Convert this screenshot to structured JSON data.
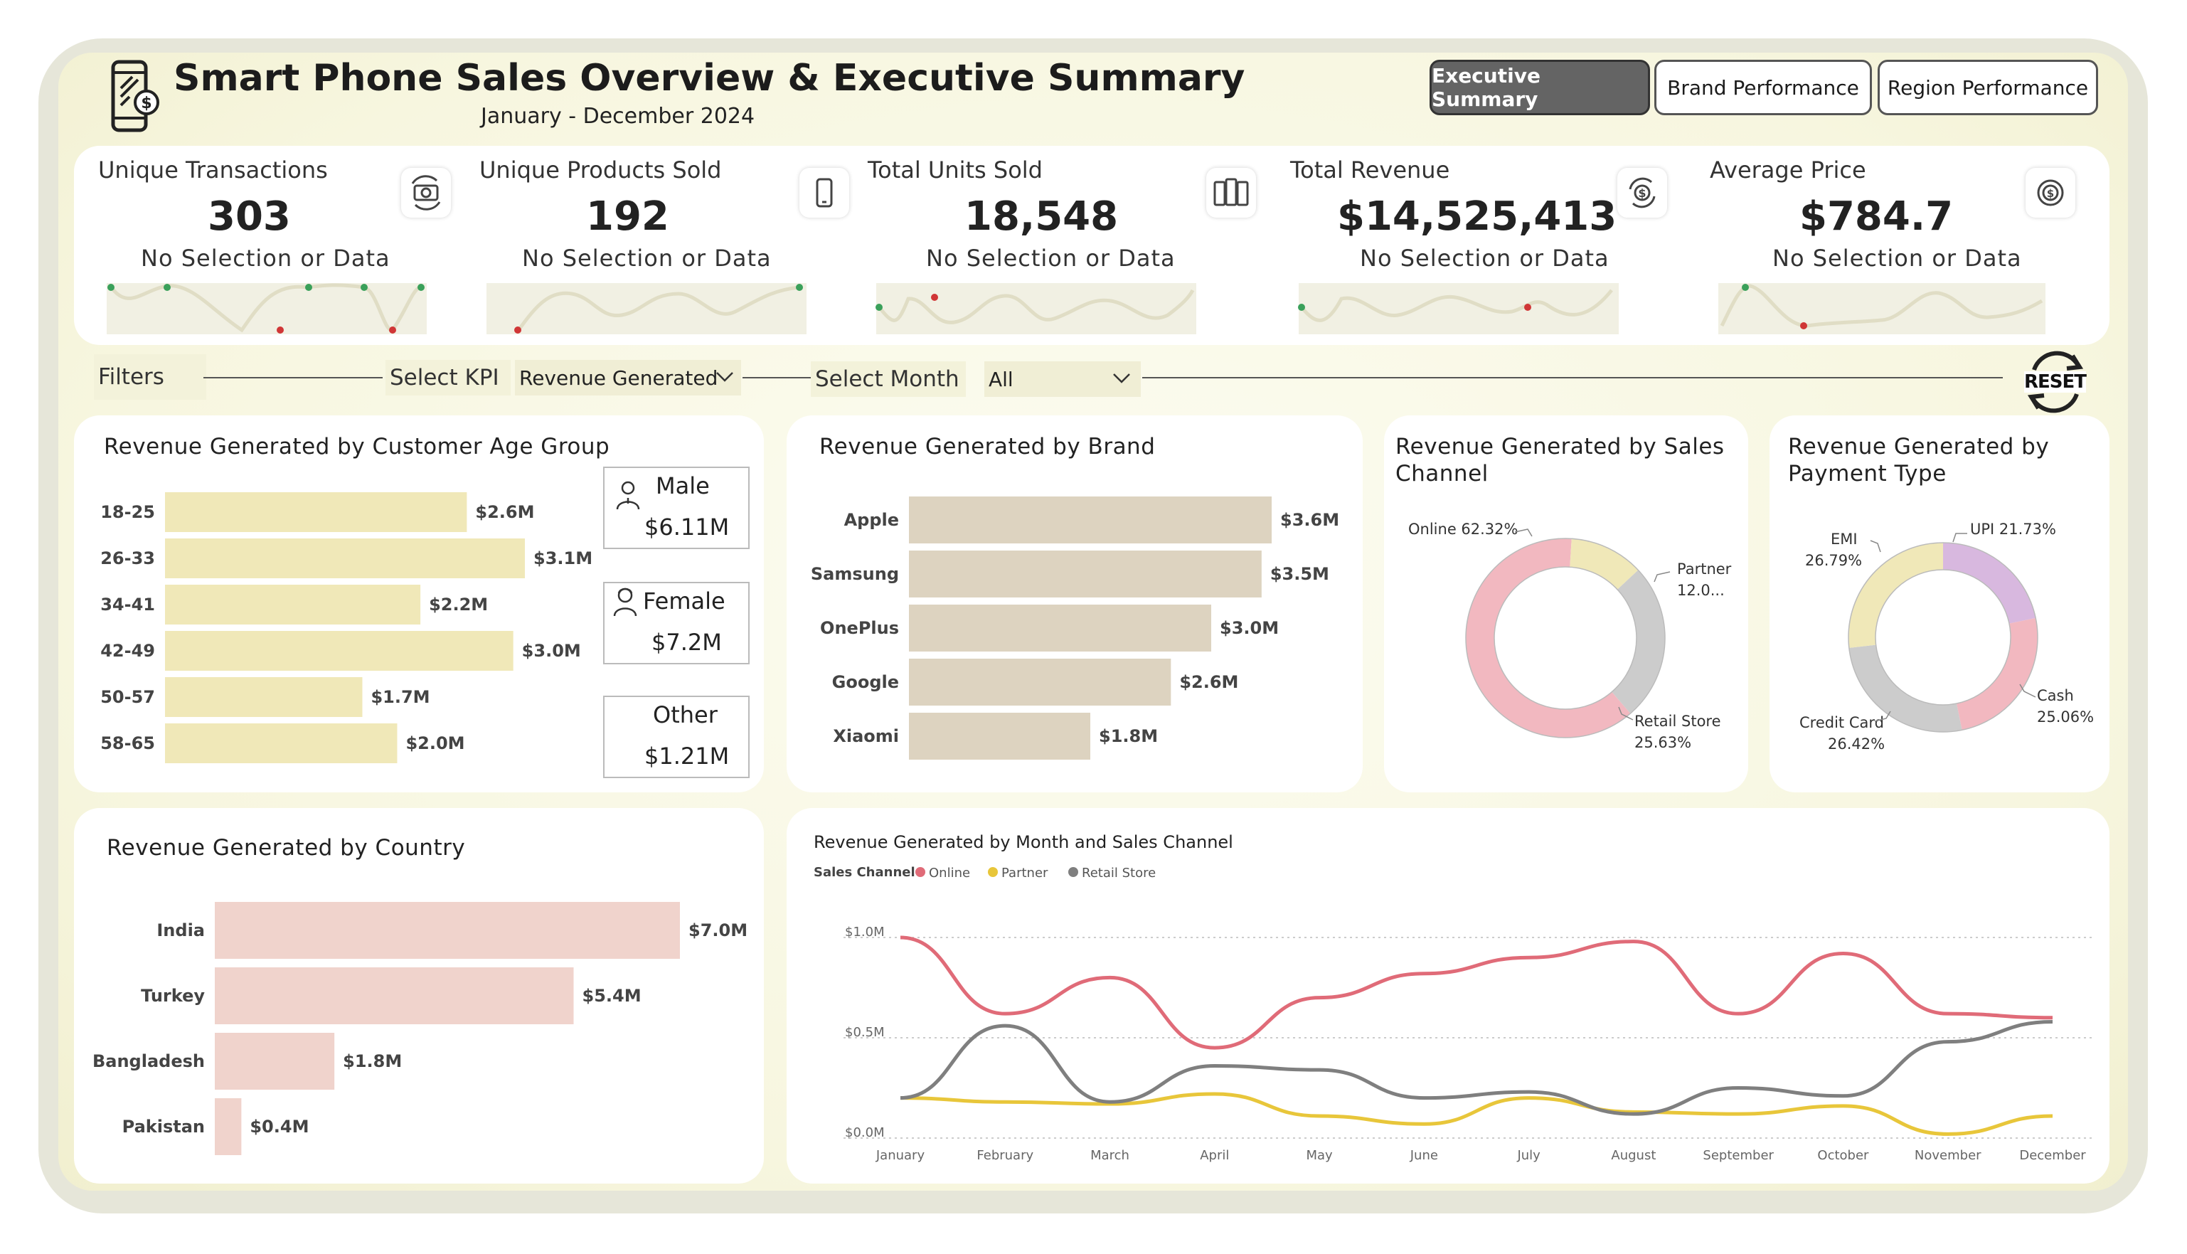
{
  "header": {
    "title": "Smart Phone Sales Overview & Executive Summary",
    "subtitle": "January - December 2024",
    "tabs": [
      "Executive Summary",
      "Brand Performance",
      "Region Performance"
    ],
    "active_tab": "Executive Summary"
  },
  "kpis": [
    {
      "label": "Unique Transactions",
      "value": "303",
      "sub": "No Selection or Data",
      "icon": "money-cycle-icon"
    },
    {
      "label": "Unique Products Sold",
      "value": "192",
      "sub": "No Selection or Data",
      "icon": "phone-icon"
    },
    {
      "label": "Total Units Sold",
      "value": "18,548",
      "sub": "No Selection or Data",
      "icon": "phones-stack-icon"
    },
    {
      "label": "Total Revenue",
      "value": "$14,525,413",
      "sub": "No Selection or Data",
      "icon": "dollar-cycle-icon"
    },
    {
      "label": "Average Price",
      "value": "$784.7",
      "sub": "No Selection or Data",
      "icon": "dollar-coin-icon"
    }
  ],
  "filters": {
    "label": "Filters",
    "kpi_label": "Select KPI",
    "kpi_value": "Revenue Generated",
    "month_label": "Select Month",
    "month_value": "All",
    "reset_label": "RESET"
  },
  "age_chart": {
    "title": "Revenue Generated by Customer Age Group",
    "chart_data": {
      "type": "bar",
      "categories": [
        "18-25",
        "26-33",
        "34-41",
        "42-49",
        "50-57",
        "58-65"
      ],
      "values": [
        2.6,
        3.1,
        2.2,
        3.0,
        1.7,
        2.0
      ],
      "labels": [
        "$2.6M",
        "$3.1M",
        "$2.2M",
        "$3.0M",
        "$1.7M",
        "$2.0M"
      ],
      "color": "#f0e8b8"
    }
  },
  "gender_cards": [
    {
      "label": "Male",
      "value": "$6.11M",
      "icon": "male-person-icon"
    },
    {
      "label": "Female",
      "value": "$7.2M",
      "icon": "female-person-icon"
    },
    {
      "label": "Other",
      "value": "$1.21M"
    }
  ],
  "brand_chart": {
    "title": "Revenue Generated by Brand",
    "chart_data": {
      "type": "bar",
      "categories": [
        "Apple",
        "Samsung",
        "OnePlus",
        "Google",
        "Xiaomi"
      ],
      "values": [
        3.6,
        3.5,
        3.0,
        2.6,
        1.8
      ],
      "labels": [
        "$3.6M",
        "$3.5M",
        "$3.0M",
        "$2.6M",
        "$1.8M"
      ],
      "color": "#ddd3c0"
    }
  },
  "channel_chart": {
    "title_lines": [
      "Revenue Generated by Sales",
      "Channel"
    ],
    "chart_data": {
      "type": "pie",
      "categories": [
        "Online",
        "Partner",
        "Retail Store"
      ],
      "values": [
        62.32,
        12.05,
        25.63
      ],
      "colors": [
        "#f2b8c0",
        "#f0e8b8",
        "#cccccc"
      ],
      "labels": [
        "Online 62.32%",
        "Partner",
        "12.0...",
        "Retail Store",
        "25.63%"
      ]
    }
  },
  "payment_chart": {
    "title_lines": [
      "Revenue Generated by",
      "Payment Type"
    ],
    "chart_data": {
      "type": "pie",
      "categories": [
        "UPI",
        "Cash",
        "Credit Card",
        "EMI"
      ],
      "values": [
        21.73,
        25.06,
        26.42,
        26.79
      ],
      "colors": [
        "#d8b8df",
        "#f2b8c0",
        "#cccccc",
        "#f0e8b8"
      ],
      "labels": [
        "UPI 21.73%",
        "Cash",
        "25.06%",
        "Credit Card",
        "26.42%",
        "EMI",
        "26.79%"
      ]
    }
  },
  "country_chart": {
    "title": "Revenue Generated by Country",
    "chart_data": {
      "type": "bar",
      "categories": [
        "India",
        "Turkey",
        "Bangladesh",
        "Pakistan"
      ],
      "values": [
        7.0,
        5.4,
        1.8,
        0.4
      ],
      "labels": [
        "$7.0M",
        "$5.4M",
        "$1.8M",
        "$0.4M"
      ],
      "color": "#f0d3cc"
    }
  },
  "month_chart": {
    "title": "Revenue Generated by Month and Sales Channel",
    "legend_title": "Sales Channel",
    "chart_data": {
      "type": "line",
      "x": [
        "January",
        "February",
        "March",
        "April",
        "May",
        "June",
        "July",
        "August",
        "September",
        "October",
        "November",
        "December"
      ],
      "y_ticks": [
        "$0.0M",
        "$0.5M",
        "$1.0M"
      ],
      "ylim": [
        0,
        1.0
      ],
      "series": [
        {
          "name": "Online",
          "color": "#e06b78",
          "values": [
            1.0,
            0.62,
            0.8,
            0.45,
            0.7,
            0.82,
            0.9,
            0.98,
            0.62,
            0.92,
            0.62,
            0.6
          ]
        },
        {
          "name": "Partner",
          "color": "#e8c63a",
          "values": [
            0.2,
            0.18,
            0.17,
            0.22,
            0.11,
            0.07,
            0.2,
            0.13,
            0.12,
            0.16,
            0.02,
            0.11
          ]
        },
        {
          "name": "Retail Store",
          "color": "#7f7f7f",
          "values": [
            0.2,
            0.56,
            0.18,
            0.36,
            0.34,
            0.2,
            0.23,
            0.12,
            0.25,
            0.21,
            0.48,
            0.58
          ]
        }
      ]
    }
  }
}
